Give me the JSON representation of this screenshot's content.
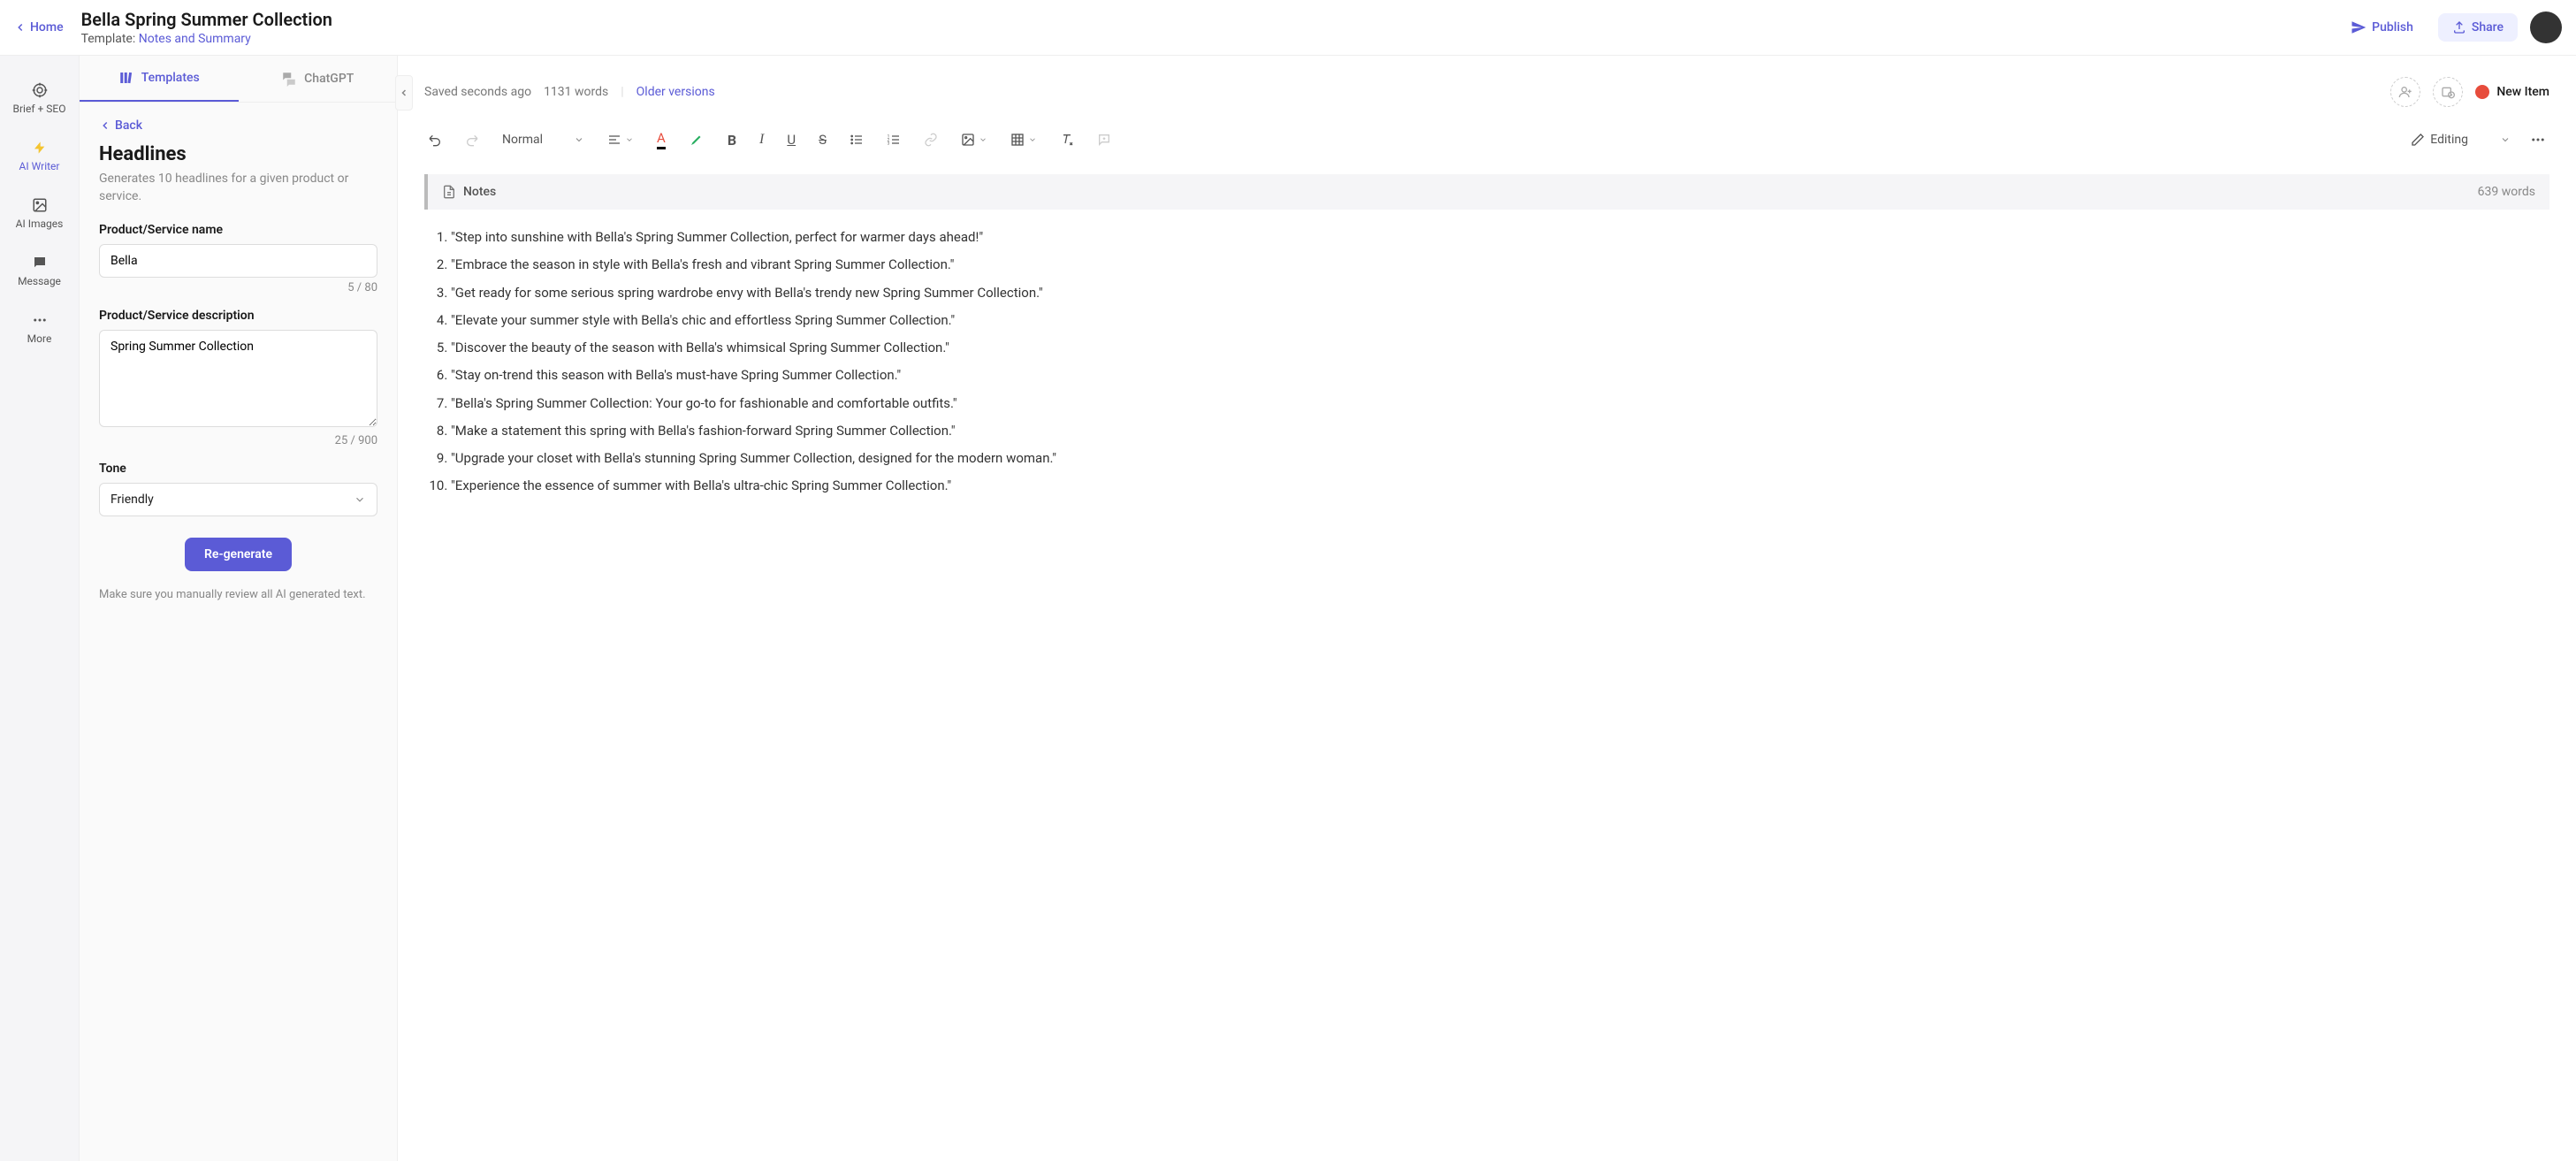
{
  "header": {
    "home": "Home",
    "title": "Bella Spring Summer Collection",
    "template_prefix": "Template: ",
    "template_name": "Notes and Summary",
    "publish": "Publish",
    "share": "Share"
  },
  "sidenav": {
    "brief": "Brief + SEO",
    "writer": "AI Writer",
    "images": "AI Images",
    "message": "Message",
    "more": "More"
  },
  "panel": {
    "tab_templates": "Templates",
    "tab_chatgpt": "ChatGPT",
    "back": "Back",
    "heading": "Headlines",
    "subtitle": "Generates 10 headlines for a given product or service.",
    "name_label": "Product/Service name",
    "name_value": "Bella",
    "name_counter": "5 / 80",
    "desc_label": "Product/Service description",
    "desc_value": "Spring Summer Collection",
    "desc_counter": "25 / 900",
    "tone_label": "Tone",
    "tone_value": "Friendly",
    "regenerate": "Re-generate",
    "disclaimer": "Make sure you manually review all AI generated text."
  },
  "editor": {
    "saved": "Saved seconds ago",
    "words": "1131 words",
    "older": "Older versions",
    "new_item": "New Item",
    "style_normal": "Normal",
    "editing_mode": "Editing",
    "notes_label": "Notes",
    "notes_words": "639 words",
    "items": [
      "\"Step into sunshine with Bella's Spring Summer Collection, perfect for warmer days ahead!\"",
      "\"Embrace the season in style with Bella's fresh and vibrant Spring Summer Collection.\"",
      "\"Get ready for some serious spring wardrobe envy with Bella's trendy new Spring Summer Collection.\"",
      "\"Elevate your summer style with Bella's chic and effortless Spring Summer Collection.\"",
      "\"Discover the beauty of the season with Bella's whimsical Spring Summer Collection.\"",
      "\"Stay on-trend this season with Bella's must-have Spring Summer Collection.\"",
      "\"Bella's Spring Summer Collection: Your go-to for fashionable and comfortable outfits.\"",
      "\"Make a statement this spring with Bella's fashion-forward Spring Summer Collection.\"",
      "\"Upgrade your closet with Bella's stunning Spring Summer Collection, designed for the modern woman.\"",
      "\"Experience the essence of summer with Bella's ultra-chic Spring Summer Collection.\""
    ]
  }
}
